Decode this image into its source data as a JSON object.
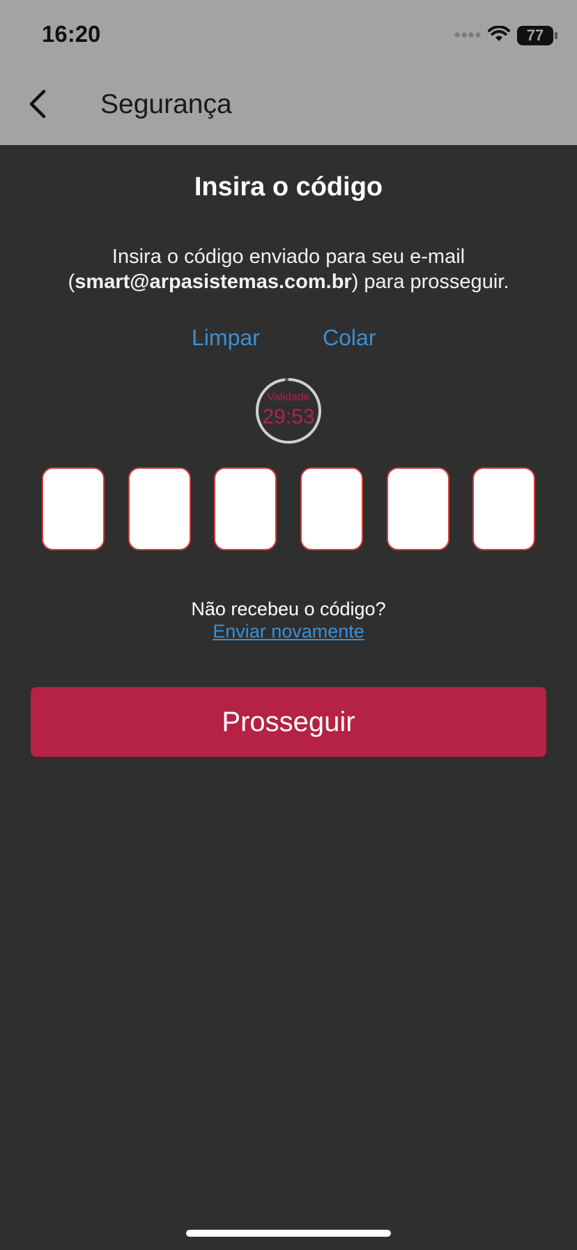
{
  "status_bar": {
    "time": "16:20",
    "battery": "77"
  },
  "header": {
    "title": "Segurança",
    "back_icon": "chevron-left-icon"
  },
  "content": {
    "heading": "Insira o código",
    "description_prefix": "Insira o código enviado para seu e-mail (",
    "email": "smart@arpasistemas.com.br",
    "description_suffix": ") para prosseguir.",
    "clear_label": "Limpar",
    "paste_label": "Colar",
    "timer": {
      "label": "Validade",
      "value": "29:53",
      "remaining_fraction": 0.98
    },
    "code_fields": [
      "",
      "",
      "",
      "",
      "",
      ""
    ],
    "resend_question": "Não recebeu o código?",
    "resend_link": "Enviar novamente",
    "submit_label": "Prosseguir"
  },
  "colors": {
    "accent_red": "#b52243",
    "link_blue": "#3b8fd6",
    "background": "#2f2f2f",
    "header_bg": "#a3a3a3"
  }
}
